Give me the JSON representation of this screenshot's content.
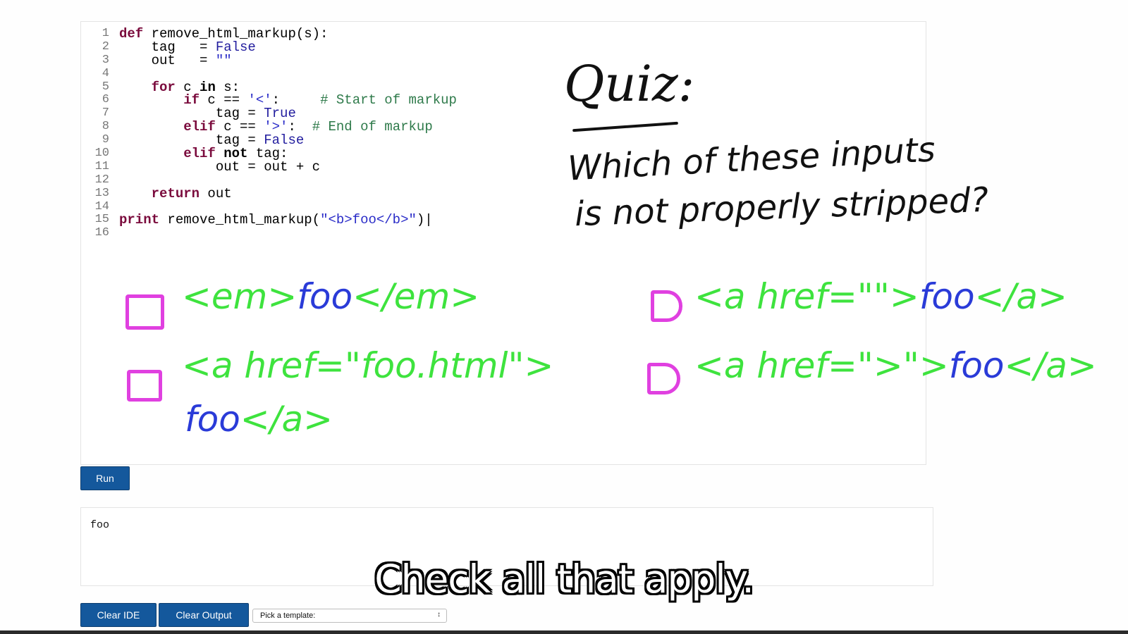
{
  "editor": {
    "lines": [
      {
        "n": "1",
        "parts": [
          {
            "t": "def ",
            "c": "kw"
          },
          {
            "t": "remove_html_markup(s):",
            "c": "code-text"
          }
        ]
      },
      {
        "n": "2",
        "parts": [
          {
            "t": "    tag   = ",
            "c": "code-text"
          },
          {
            "t": "False",
            "c": "bi"
          }
        ]
      },
      {
        "n": "3",
        "parts": [
          {
            "t": "    out   = ",
            "c": "code-text"
          },
          {
            "t": "\"\"",
            "c": "str"
          }
        ]
      },
      {
        "n": "4",
        "parts": []
      },
      {
        "n": "5",
        "parts": [
          {
            "t": "    ",
            "c": "code-text"
          },
          {
            "t": "for",
            "c": "kw"
          },
          {
            "t": " c ",
            "c": "code-text"
          },
          {
            "t": "in",
            "c": "kwb"
          },
          {
            "t": " s:",
            "c": "code-text"
          }
        ]
      },
      {
        "n": "6",
        "parts": [
          {
            "t": "        ",
            "c": "code-text"
          },
          {
            "t": "if",
            "c": "kw"
          },
          {
            "t": " c == ",
            "c": "code-text"
          },
          {
            "t": "'<'",
            "c": "str"
          },
          {
            "t": ":     ",
            "c": "code-text"
          },
          {
            "t": "# Start of markup",
            "c": "cmt"
          }
        ]
      },
      {
        "n": "7",
        "parts": [
          {
            "t": "            tag = ",
            "c": "code-text"
          },
          {
            "t": "True",
            "c": "bi"
          }
        ]
      },
      {
        "n": "8",
        "parts": [
          {
            "t": "        ",
            "c": "code-text"
          },
          {
            "t": "elif",
            "c": "kw"
          },
          {
            "t": " c == ",
            "c": "code-text"
          },
          {
            "t": "'>'",
            "c": "str"
          },
          {
            "t": ":  ",
            "c": "code-text"
          },
          {
            "t": "# End of markup",
            "c": "cmt"
          }
        ]
      },
      {
        "n": "9",
        "parts": [
          {
            "t": "            tag = ",
            "c": "code-text"
          },
          {
            "t": "False",
            "c": "bi"
          }
        ]
      },
      {
        "n": "10",
        "parts": [
          {
            "t": "        ",
            "c": "code-text"
          },
          {
            "t": "elif",
            "c": "kw"
          },
          {
            "t": " ",
            "c": "code-text"
          },
          {
            "t": "not",
            "c": "kwb"
          },
          {
            "t": " tag:",
            "c": "code-text"
          }
        ]
      },
      {
        "n": "11",
        "parts": [
          {
            "t": "            out = out + c",
            "c": "code-text"
          }
        ]
      },
      {
        "n": "12",
        "parts": []
      },
      {
        "n": "13",
        "parts": [
          {
            "t": "    ",
            "c": "code-text"
          },
          {
            "t": "return",
            "c": "kw"
          },
          {
            "t": " out",
            "c": "code-text"
          }
        ]
      },
      {
        "n": "14",
        "parts": []
      },
      {
        "n": "15",
        "parts": [
          {
            "t": "print",
            "c": "kw"
          },
          {
            "t": " remove_html_markup(",
            "c": "code-text"
          },
          {
            "t": "\"<b>foo</b>\"",
            "c": "str"
          },
          {
            "t": ")|",
            "c": "code-text"
          }
        ]
      },
      {
        "n": "16",
        "parts": []
      }
    ]
  },
  "quiz": {
    "title": "Quiz:",
    "question_line1": "Which of these inputs",
    "question_line2": "is not properly stripped?",
    "options": {
      "o1_green1": "<em>",
      "o1_blue": "foo",
      "o1_green2": "</em>",
      "o2_line1": "<a href=\"foo.html\">",
      "o2_blue": "foo",
      "o2_green": "</a>",
      "o3_green1": "<a href=\"\">",
      "o3_blue": "foo",
      "o3_green2": "</a>",
      "o4_green1": "<a href=\">\">",
      "o4_blue": "foo",
      "o4_green2": "</a>"
    },
    "colors": {
      "checkbox": "#e040e0",
      "markup": "#3ee33e",
      "text": "#2a3bd8"
    }
  },
  "run_label": "Run",
  "output_text": "foo",
  "caption": "Check all that apply.",
  "toolbar": {
    "clear_ide": "Clear IDE",
    "clear_output": "Clear Output",
    "template_select": "Pick a template:"
  },
  "colors": {
    "button": "#14589c"
  }
}
